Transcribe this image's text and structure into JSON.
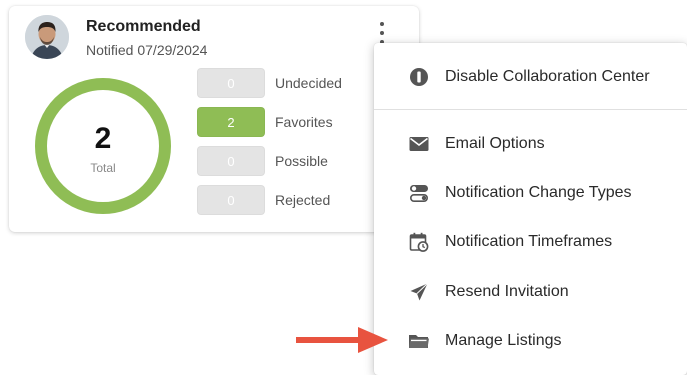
{
  "card": {
    "title": "Recommended",
    "subtitle": "Notified 07/29/2024",
    "total": {
      "value": "2",
      "label": "Total"
    },
    "stats": [
      {
        "count": "0",
        "label": "Undecided",
        "active": false
      },
      {
        "count": "2",
        "label": "Favorites",
        "active": true
      },
      {
        "count": "0",
        "label": "Possible",
        "active": false
      },
      {
        "count": "0",
        "label": "Rejected",
        "active": false
      }
    ]
  },
  "menu": {
    "items": [
      {
        "label": "Disable Collaboration Center",
        "icon": "disable-icon"
      },
      {
        "label": "Email Options",
        "icon": "envelope-icon"
      },
      {
        "label": "Notification Change Types",
        "icon": "toggle-icon"
      },
      {
        "label": "Notification Timeframes",
        "icon": "calendar-clock-icon"
      },
      {
        "label": "Resend Invitation",
        "icon": "send-icon"
      },
      {
        "label": "Manage Listings",
        "icon": "folder-open-icon"
      }
    ]
  },
  "colors": {
    "accent_green": "#8fbd55",
    "donut_green": "#8fbd55",
    "pill_gray": "#e4e4e4",
    "annotation_red": "#e8533f",
    "icon_gray": "#555555"
  }
}
